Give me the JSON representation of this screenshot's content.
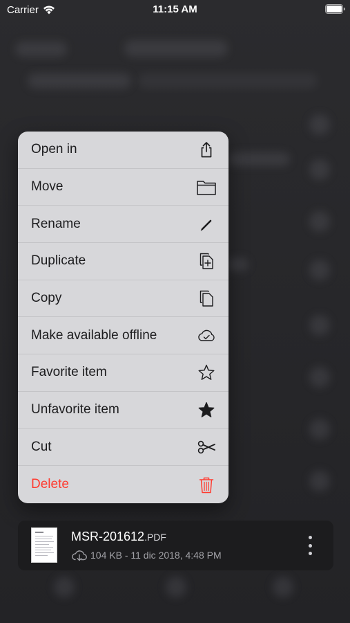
{
  "status_bar": {
    "carrier": "Carrier",
    "time": "11:15 AM",
    "icons": {
      "wifi": "wifi-icon",
      "battery": "battery-icon"
    }
  },
  "context_menu": {
    "items": [
      {
        "label": "Open in",
        "icon": "share-icon",
        "destructive": false
      },
      {
        "label": "Move",
        "icon": "folder-icon",
        "destructive": false
      },
      {
        "label": "Rename",
        "icon": "pencil-icon",
        "destructive": false
      },
      {
        "label": "Duplicate",
        "icon": "duplicate-icon",
        "destructive": false
      },
      {
        "label": "Copy",
        "icon": "copy-icon",
        "destructive": false
      },
      {
        "label": "Make available offline",
        "icon": "cloud-check-icon",
        "destructive": false
      },
      {
        "label": "Favorite item",
        "icon": "star-outline-icon",
        "destructive": false
      },
      {
        "label": "Unfavorite item",
        "icon": "star-filled-icon",
        "destructive": false
      },
      {
        "label": "Cut",
        "icon": "scissors-icon",
        "destructive": false
      },
      {
        "label": "Delete",
        "icon": "trash-icon",
        "destructive": true
      }
    ]
  },
  "file": {
    "name": "MSR-201612",
    "extension": ".PDF",
    "meta": "104 KB - 11 dic 2018, 4:48 PM",
    "cloud_icon": "cloud-download-icon",
    "more_icon": "more-vertical-icon"
  },
  "colors": {
    "menu_background": "#d7d7da",
    "destructive": "#ff3b30",
    "card_background": "#1c1c1e"
  }
}
